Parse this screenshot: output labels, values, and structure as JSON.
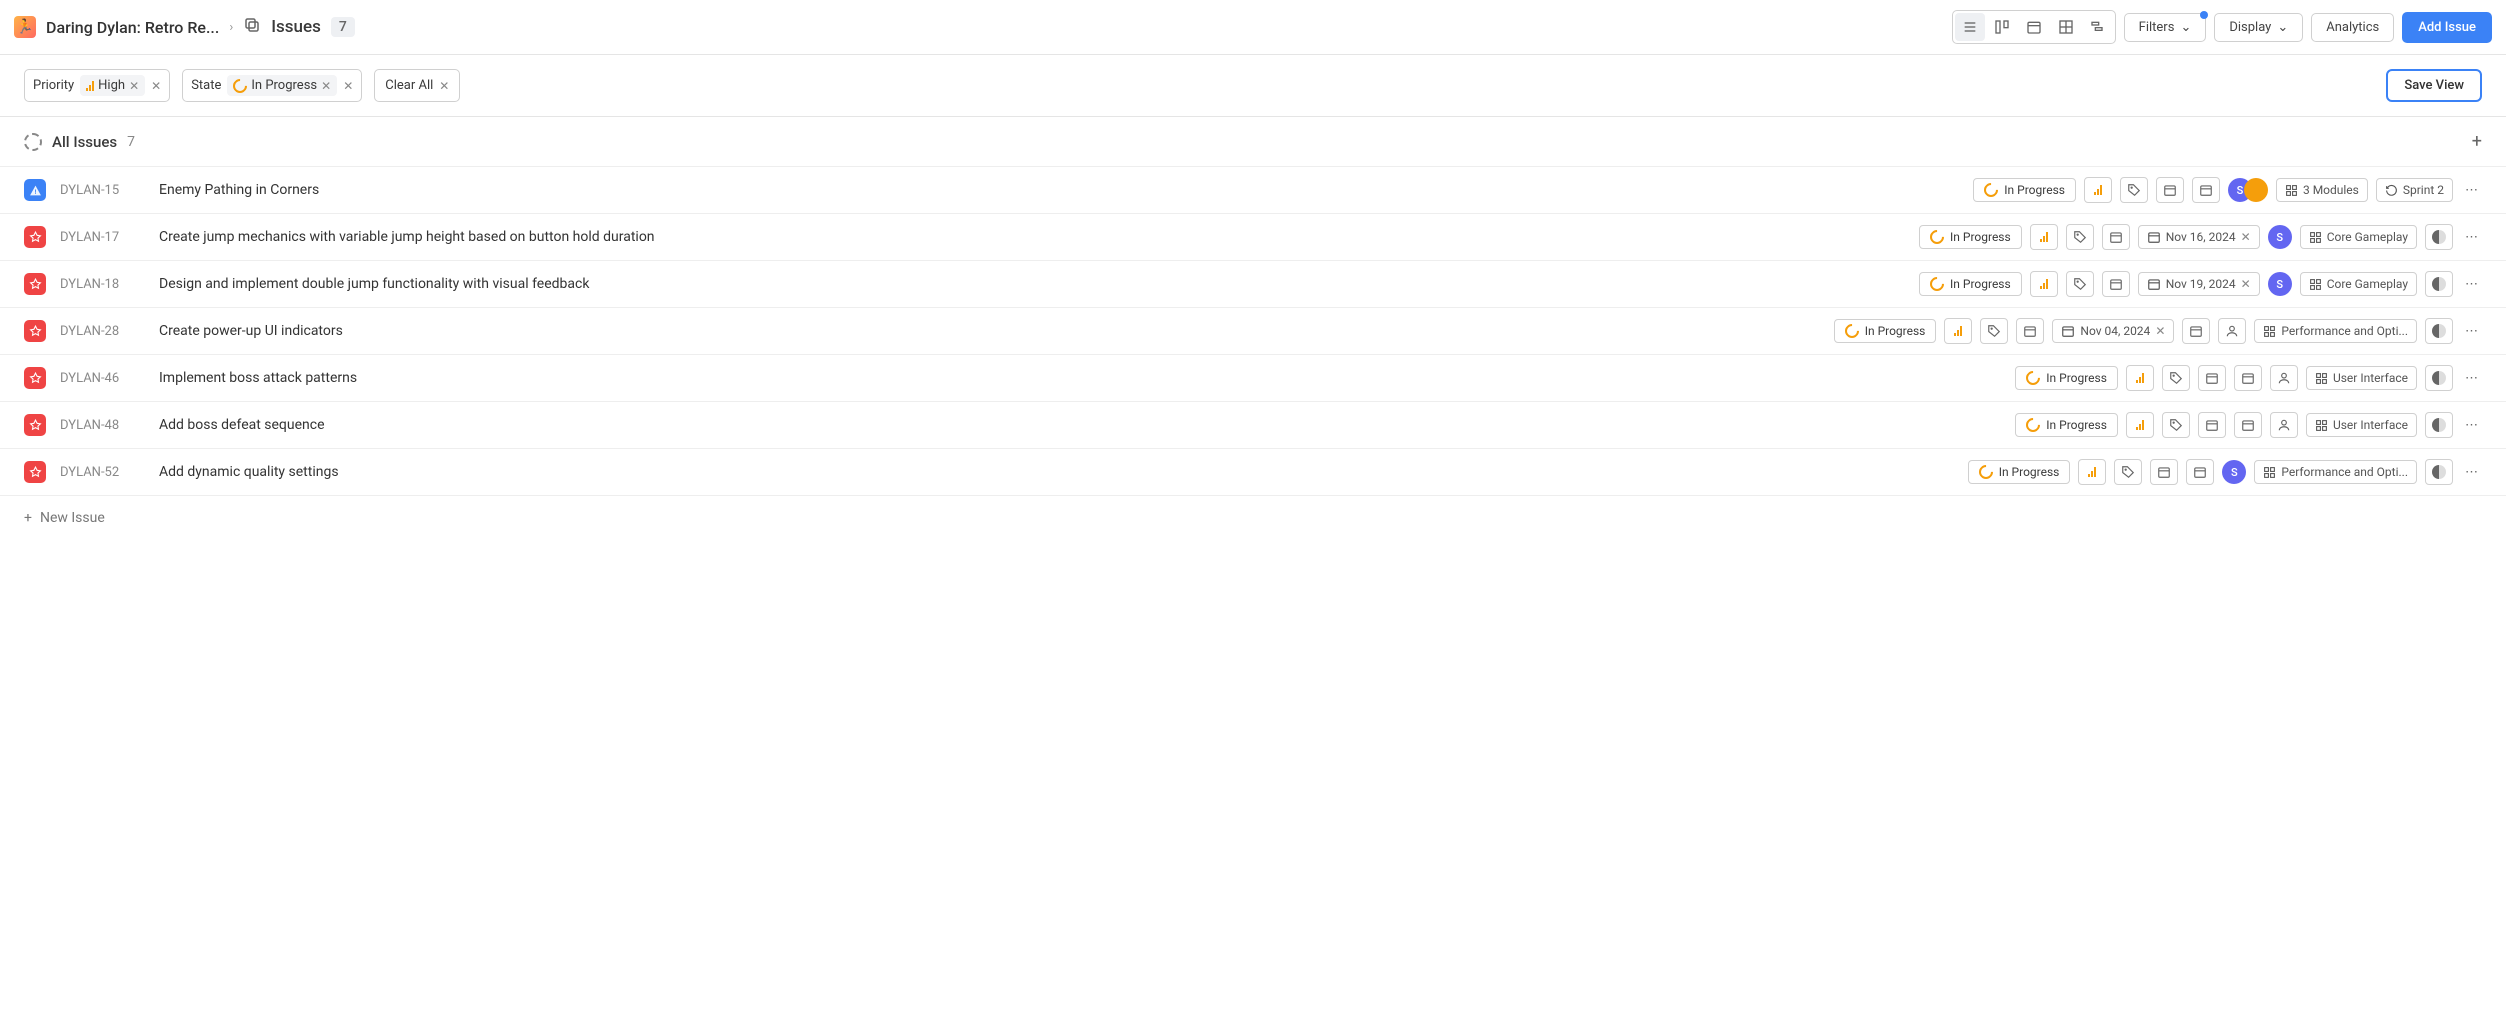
{
  "header": {
    "project_name": "Daring Dylan: Retro Re...",
    "issues_label": "Issues",
    "issues_count": "7",
    "filters_label": "Filters",
    "display_label": "Display",
    "analytics_label": "Analytics",
    "add_issue_label": "Add Issue"
  },
  "filters": {
    "priority_label": "Priority",
    "priority_value": "High",
    "state_label": "State",
    "state_value": "In Progress",
    "clear_all_label": "Clear All",
    "save_view_label": "Save View"
  },
  "group": {
    "title": "All Issues",
    "count": "7"
  },
  "rows": [
    {
      "type": "blue",
      "id": "DYLAN-15",
      "title": "Enemy Pathing in Corners",
      "state": "In Progress",
      "date": null,
      "avatars": 2,
      "avatar_letter": "S",
      "module": "3 Modules",
      "cycle": "Sprint 2",
      "half": false
    },
    {
      "type": "red",
      "id": "DYLAN-17",
      "title": "Create jump mechanics with variable jump height based on button hold duration",
      "state": "In Progress",
      "date": "Nov 16, 2024",
      "avatars": 1,
      "avatar_letter": "S",
      "module": "Core Gameplay",
      "cycle": null,
      "half": true
    },
    {
      "type": "red",
      "id": "DYLAN-18",
      "title": "Design and implement double jump functionality with visual feedback",
      "state": "In Progress",
      "date": "Nov 19, 2024",
      "avatars": 1,
      "avatar_letter": "S",
      "module": "Core Gameplay",
      "cycle": null,
      "half": true
    },
    {
      "type": "red",
      "id": "DYLAN-28",
      "title": "Create power-up UI indicators",
      "state": "In Progress",
      "date": "Nov 04, 2024",
      "avatars": 0,
      "avatar_letter": "",
      "module": "Performance and Opti...",
      "cycle": null,
      "half": true,
      "extra_cal": true,
      "user_placeholder": true
    },
    {
      "type": "red",
      "id": "DYLAN-46",
      "title": "Implement boss attack patterns",
      "state": "In Progress",
      "date": null,
      "avatars": 0,
      "avatar_letter": "",
      "module": "User Interface",
      "cycle": null,
      "half": true,
      "two_cal": true,
      "user_placeholder": true
    },
    {
      "type": "red",
      "id": "DYLAN-48",
      "title": "Add boss defeat sequence",
      "state": "In Progress",
      "date": null,
      "avatars": 0,
      "avatar_letter": "",
      "module": "User Interface",
      "cycle": null,
      "half": true,
      "two_cal": true,
      "user_placeholder": true
    },
    {
      "type": "red",
      "id": "DYLAN-52",
      "title": "Add dynamic quality settings",
      "state": "In Progress",
      "date": null,
      "avatars": 1,
      "avatar_letter": "S",
      "module": "Performance and Opti...",
      "cycle": null,
      "half": true,
      "two_cal": true
    }
  ],
  "new_issue_label": "New Issue"
}
